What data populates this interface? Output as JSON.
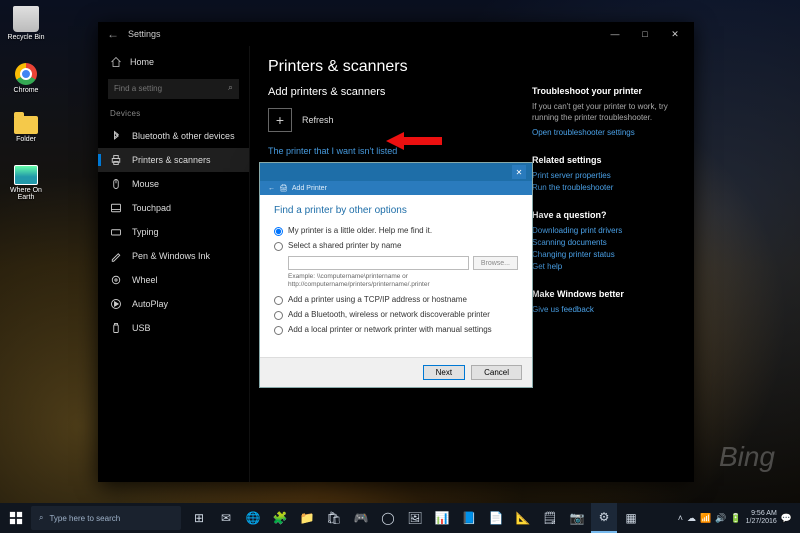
{
  "desktop": {
    "watermark": "Bing",
    "icons": [
      {
        "label": "Recycle Bin"
      },
      {
        "label": "Chrome"
      },
      {
        "label": "Folder"
      },
      {
        "label": "Where On Earth"
      }
    ]
  },
  "window": {
    "app": "Settings",
    "controls": {
      "min": "—",
      "max": "□",
      "close": "✕",
      "back": "←"
    }
  },
  "sidebar": {
    "home": "Home",
    "search_placeholder": "Find a setting",
    "category": "Devices",
    "items": [
      {
        "label": "Bluetooth & other devices"
      },
      {
        "label": "Printers & scanners"
      },
      {
        "label": "Mouse"
      },
      {
        "label": "Touchpad"
      },
      {
        "label": "Typing"
      },
      {
        "label": "Pen & Windows Ink"
      },
      {
        "label": "Wheel"
      },
      {
        "label": "AutoPlay"
      },
      {
        "label": "USB"
      }
    ],
    "active_index": 1
  },
  "page": {
    "title": "Printers & scanners",
    "section": "Add printers & scanners",
    "refresh": "Refresh",
    "not_listed": "The printer that I want isn't listed"
  },
  "right": {
    "troubleshoot": {
      "heading": "Troubleshoot your printer",
      "body": "If you can't get your printer to work, try running the printer troubleshooter.",
      "link": "Open troubleshooter settings"
    },
    "related": {
      "heading": "Related settings",
      "links": [
        "Print server properties",
        "Run the troubleshooter"
      ]
    },
    "question": {
      "heading": "Have a question?",
      "links": [
        "Downloading print drivers",
        "Scanning documents",
        "Changing printer status",
        "Get help"
      ]
    },
    "better": {
      "heading": "Make Windows better",
      "links": [
        "Give us feedback"
      ]
    }
  },
  "dialog": {
    "title": "",
    "breadcrumb": "Add Printer",
    "heading": "Find a printer by other options",
    "options": [
      "My printer is a little older. Help me find it.",
      "Select a shared printer by name",
      "Add a printer using a TCP/IP address or hostname",
      "Add a Bluetooth, wireless or network discoverable printer",
      "Add a local printer or network printer with manual settings"
    ],
    "browse": "Browse...",
    "example": "Example: \\\\computername\\printername or http://computername/printers/printername/.printer",
    "next": "Next",
    "cancel": "Cancel",
    "close": "✕",
    "back": "←"
  },
  "taskbar": {
    "search_placeholder": "Type here to search",
    "time": "9:56 AM",
    "date": "1/27/2016"
  }
}
